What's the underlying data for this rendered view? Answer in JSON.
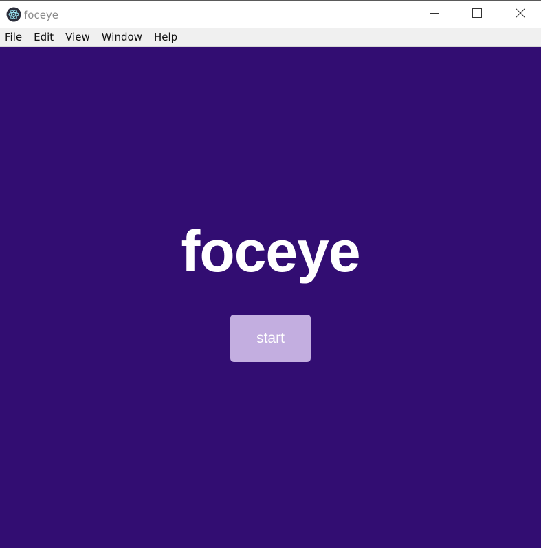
{
  "window": {
    "title": "foceye",
    "app_icon": "electron-atom-icon",
    "controls": [
      "minimize-icon",
      "maximize-icon",
      "close-icon"
    ]
  },
  "menu": {
    "items": [
      "File",
      "Edit",
      "View",
      "Window",
      "Help"
    ]
  },
  "main": {
    "heading": "foceye",
    "start_label": "start"
  },
  "colors": {
    "background": "#320d72",
    "button": "#c3aee0",
    "heading": "#ffffff"
  }
}
